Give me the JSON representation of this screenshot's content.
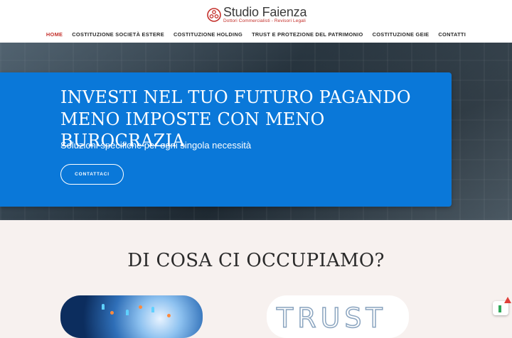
{
  "brand": {
    "name": "Studio Faienza",
    "tagline": "Dottori Commercialisti - Revisori Legali",
    "accent_color": "#c4302b"
  },
  "nav": {
    "items": [
      {
        "label": "HOME",
        "active": true
      },
      {
        "label": "COSTITUZIONE SOCIETÀ ESTERE",
        "active": false
      },
      {
        "label": "COSTITUZIONE HOLDING",
        "active": false
      },
      {
        "label": "TRUST E PROTEZIONE DEL PATRIMONIO",
        "active": false
      },
      {
        "label": "COSTITUZIONE GEIE",
        "active": false
      },
      {
        "label": "CONTATTI",
        "active": false
      }
    ]
  },
  "hero": {
    "headline": "INVESTI NEL TUO FUTURO PAGANDO MENO IMPOSTE CON MENO BUROCRAZIA",
    "subtitle": "Soluzioni specifiche per ogni singola necessità",
    "cta_label": "CONTATTACI",
    "box_color": "#0a78d9"
  },
  "services": {
    "title": "DI COSA CI OCCUPIAMO?",
    "cards": [
      {
        "image": "network-people-globe-image"
      },
      {
        "image": "trust-word-image",
        "text": "TRUST"
      }
    ]
  },
  "widget": {
    "icon": "recaptcha-badge-icon"
  }
}
